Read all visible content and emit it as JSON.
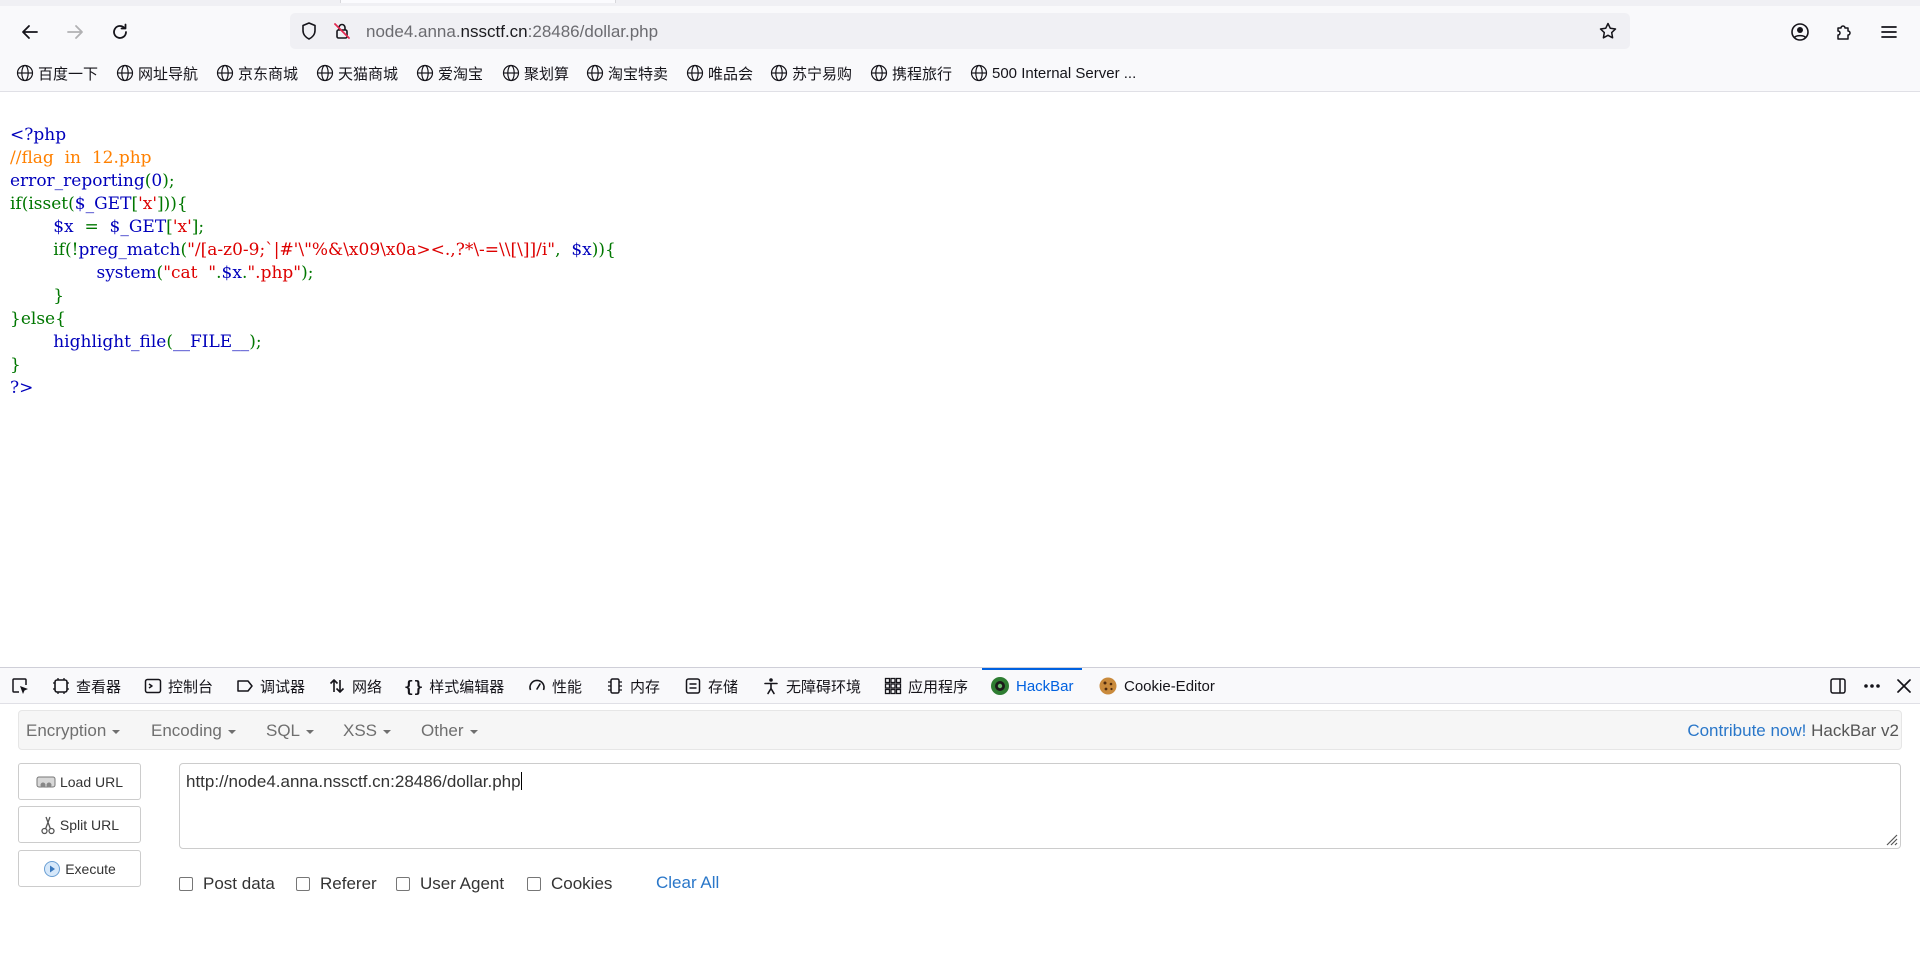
{
  "browser": {
    "url_prefix": "node4.anna.",
    "url_host": "nssctf.cn",
    "url_suffix": ":28486/dollar.php"
  },
  "bookmarks": [
    "百度一下",
    "网址导航",
    "京东商城",
    "天猫商城",
    "爱淘宝",
    "聚划算",
    "淘宝特卖",
    "唯品会",
    "苏宁易购",
    "携程旅行",
    "500 Internal Server ..."
  ],
  "source_code": {
    "l1": "<?php",
    "l2": "//flag  in  12.php",
    "l3a": "error_reporting",
    "l3b": "(",
    "l3c": "0",
    "l3d": ");",
    "l4a": "if(isset(",
    "l4b": "$_GET",
    "l4c": "[",
    "l4d": "'x'",
    "l4e": "])){",
    "l5a": "        $x  ",
    "l5b": "=  ",
    "l5c": "$_GET",
    "l5d": "[",
    "l5e": "'x'",
    "l5f": "];",
    "l6a": "        if(!",
    "l6b": "preg_match",
    "l6c": "(",
    "l6d": "\"/[a-z0-9;`|#'\\\"%&\\x09\\x0a><.,?*\\-=\\\\[\\]]/i\"",
    "l6e": ",  ",
    "l6f": "$x",
    "l6g": ")){",
    "l7a": "                ",
    "l7b": "system",
    "l7c": "(",
    "l7d": "\"cat  \"",
    "l7e": ".",
    "l7f": "$x",
    "l7g": ".",
    "l7h": "\".php\"",
    "l7i": ");",
    "l8": "        }",
    "l9": "}else{",
    "l10a": "        highlight_file",
    "l10b": "(",
    "l10c": "__FILE__",
    "l10d": ");",
    "l11": "}",
    "l12": "?>"
  },
  "devtools": {
    "tabs": [
      "查看器",
      "控制台",
      "调试器",
      "网络",
      "样式编辑器",
      "性能",
      "内存",
      "存储",
      "无障碍环境",
      "应用程序",
      "HackBar",
      "Cookie-Editor"
    ],
    "active_tab": "HackBar",
    "accent_color": "#0061e0"
  },
  "hackbar": {
    "menus": [
      "Encryption",
      "Encoding",
      "SQL",
      "XSS",
      "Other"
    ],
    "contribute": "Contribute now!",
    "version": "HackBar v2",
    "buttons": {
      "load": "Load URL",
      "split": "Split URL",
      "execute": "Execute"
    },
    "url_value": "http://node4.anna.nssctf.cn:28486/dollar.php",
    "options": [
      "Post data",
      "Referer",
      "User Agent",
      "Cookies"
    ],
    "clear_all": "Clear All"
  }
}
